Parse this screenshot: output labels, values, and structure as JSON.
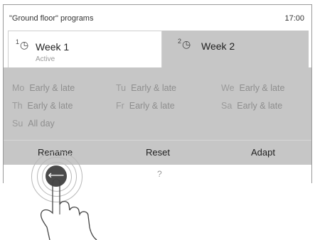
{
  "header": {
    "title": "\"Ground floor\" programs",
    "time": "17:00"
  },
  "tabs": [
    {
      "label": "Week 1",
      "sub": "Active",
      "icon": "clock-icon",
      "icon_sup": "1"
    },
    {
      "label": "Week 2",
      "icon": "clock-icon",
      "icon_sup": "2"
    }
  ],
  "schedule": [
    {
      "day": "Mo",
      "program": "Early & late"
    },
    {
      "day": "Tu",
      "program": "Early & late"
    },
    {
      "day": "We",
      "program": "Early & late"
    },
    {
      "day": "Th",
      "program": "Early & late"
    },
    {
      "day": "Fr",
      "program": "Early & late"
    },
    {
      "day": "Sa",
      "program": "Early & late"
    },
    {
      "day": "Su",
      "program": "All day"
    }
  ],
  "actions": {
    "rename": "Rename",
    "reset": "Reset",
    "adapt": "Adapt"
  },
  "footer": {
    "back_icon": "back-arrow-icon",
    "help": "?"
  }
}
